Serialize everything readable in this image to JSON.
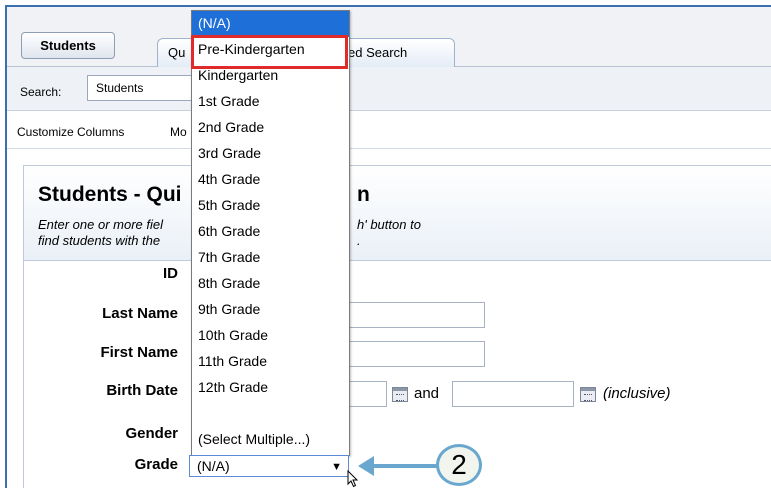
{
  "header": {
    "students_button": "Students",
    "tabs": [
      "Qu",
      "ed Search"
    ]
  },
  "search": {
    "label": "Search:",
    "value": "Students"
  },
  "links": {
    "customize_columns": "Customize Columns",
    "more": "Mo"
  },
  "panel": {
    "title_left": "Students - Qui",
    "title_right": "n",
    "desc_left_1": "Enter one or more fiel",
    "desc_left_2": "find students with the",
    "desc_right_1": "h' button to",
    "desc_right_2": "."
  },
  "form": {
    "labels": [
      "ID",
      "Last Name",
      "First Name",
      "Birth Date",
      "Gender",
      "Grade"
    ],
    "and_text": "and",
    "inclusive_text": "(inclusive)",
    "grade_value": "(N/A)"
  },
  "dropdown": {
    "options": [
      "(N/A)",
      "Pre-Kindergarten",
      "Kindergarten",
      "1st Grade",
      "2nd Grade",
      "3rd Grade",
      "4th Grade",
      "5th Grade",
      "6th Grade",
      "7th Grade",
      "8th Grade",
      "9th Grade",
      "10th Grade",
      "11th Grade",
      "12th Grade",
      "",
      "(Select Multiple...)"
    ],
    "selected_index": 0,
    "highlighted_option": "Pre-Kindergarten"
  },
  "callout": {
    "number": "2",
    "color": "#6aa7cf"
  },
  "colors": {
    "selected_option": "#1e6fd8",
    "highlight_border": "#e02b2b",
    "frame": "#3d6fb0"
  }
}
